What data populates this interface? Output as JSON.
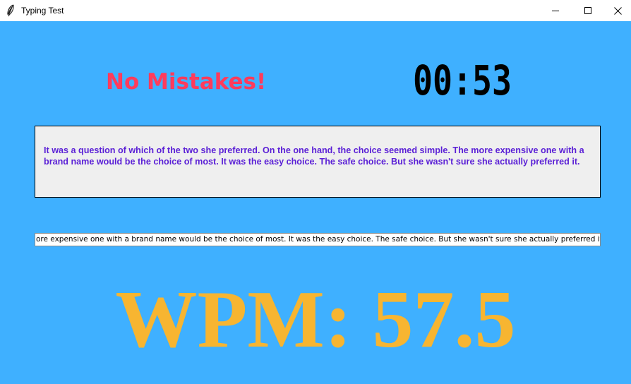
{
  "window": {
    "title": "Typing Test",
    "icon": "feather-icon",
    "controls": [
      "minimize-icon",
      "maximize-icon",
      "close-icon"
    ]
  },
  "status": {
    "message": "No Mistakes!",
    "color": "#ff3b5c"
  },
  "timer": {
    "value": "00:53",
    "color": "#000000"
  },
  "passage": {
    "text": "It was a question of which of the two she preferred. On the one hand, the choice seemed simple. The more expensive one with a brand name would be the choice of most. It was the easy choice. The safe choice. But she wasn't sure she actually preferred it.",
    "color": "#5a1fd6"
  },
  "input": {
    "value": "ore expensive one with a brand name would be the choice of most. It was the easy choice. The safe choice. But she wasn't sure she actually preferred it."
  },
  "result": {
    "wpm_text": "WPM: 57.5",
    "color": "#f7b531"
  },
  "colors": {
    "background": "#3fb0ff",
    "passage_bg": "#efefef"
  }
}
